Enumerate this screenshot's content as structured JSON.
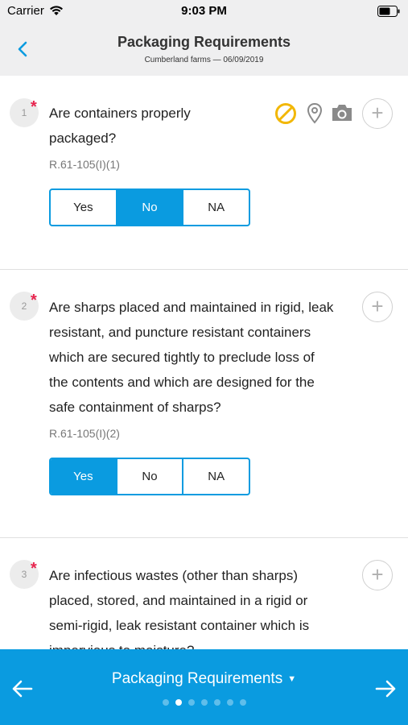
{
  "status_bar": {
    "carrier": "Carrier",
    "time": "9:03 PM"
  },
  "header": {
    "title": "Packaging Requirements",
    "subtitle": "Cumberland farms — 06/09/2019"
  },
  "questions": [
    {
      "number": "1",
      "required_mark": "*",
      "lines": [
        "Are containers properly",
        "packaged?"
      ],
      "reference": "R.61-105(I)(1)",
      "answers": [
        "Yes",
        "No",
        "NA"
      ],
      "selected": "No",
      "icons": [
        "prohibited-icon",
        "location-pin-icon",
        "camera-icon"
      ],
      "add_label": "+"
    },
    {
      "number": "2",
      "required_mark": "*",
      "lines": [
        "Are sharps placed and maintained in rigid, leak",
        "resistant, and puncture resistant containers",
        "which are secured tightly to preclude loss of",
        "the contents and which are designed for the",
        "safe containment of sharps?"
      ],
      "reference": "R.61-105(I)(2)",
      "answers": [
        "Yes",
        "No",
        "NA"
      ],
      "selected": "Yes",
      "add_label": "+"
    },
    {
      "number": "3",
      "required_mark": "*",
      "lines": [
        "Are infectious wastes (other than sharps)",
        "placed, stored, and maintained in a rigid or",
        "semi-rigid, leak resistant container which is",
        "impervious to moisture?"
      ],
      "add_label": "+"
    }
  ],
  "bottom_bar": {
    "title": "Packaging Requirements",
    "caret": "▼",
    "page_count": 7,
    "active_page": 2
  },
  "colors": {
    "accent": "#0a9be0",
    "required": "#e8254f",
    "prohibited_icon": "#f2b705",
    "header_bg": "#efeff0"
  }
}
